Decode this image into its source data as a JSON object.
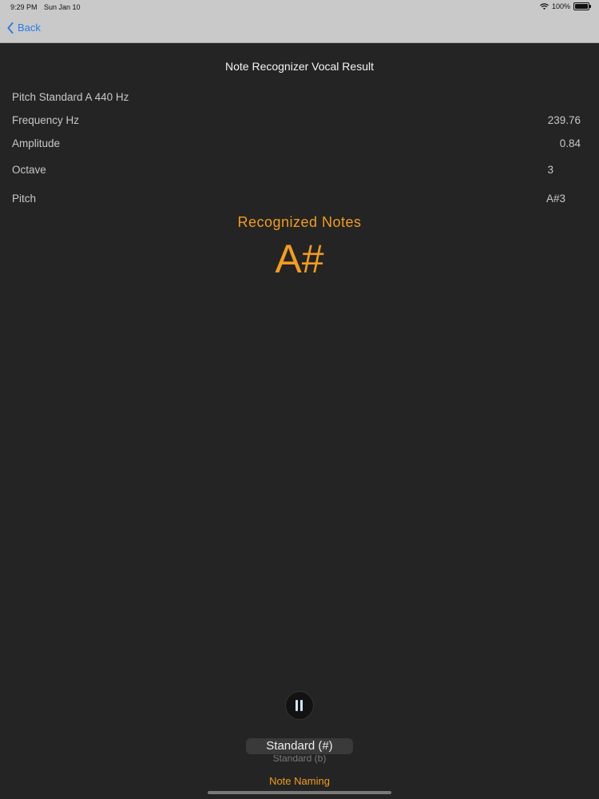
{
  "status_bar": {
    "time": "9:29 PM",
    "date": "Sun Jan 10",
    "battery": "100%"
  },
  "nav": {
    "back_label": "Back"
  },
  "title": "Note Recognizer Vocal Result",
  "rows": {
    "pitch_standard": "Pitch Standard A 440 Hz",
    "frequency_label": "Frequency Hz",
    "frequency_value": "239.76",
    "amplitude_label": "Amplitude",
    "amplitude_value": "0.84",
    "octave_label": "Octave",
    "octave_value": "3",
    "pitch_label": "Pitch",
    "pitch_value": "A#3"
  },
  "recognized": {
    "heading": "Recognized Notes",
    "note": "A#"
  },
  "picker": {
    "selected": "Standard (#)",
    "next": "Standard (b)",
    "label": "Note Naming"
  },
  "colors": {
    "accent": "#f29c1f",
    "background": "#242424",
    "link": "#2a7ae4"
  }
}
